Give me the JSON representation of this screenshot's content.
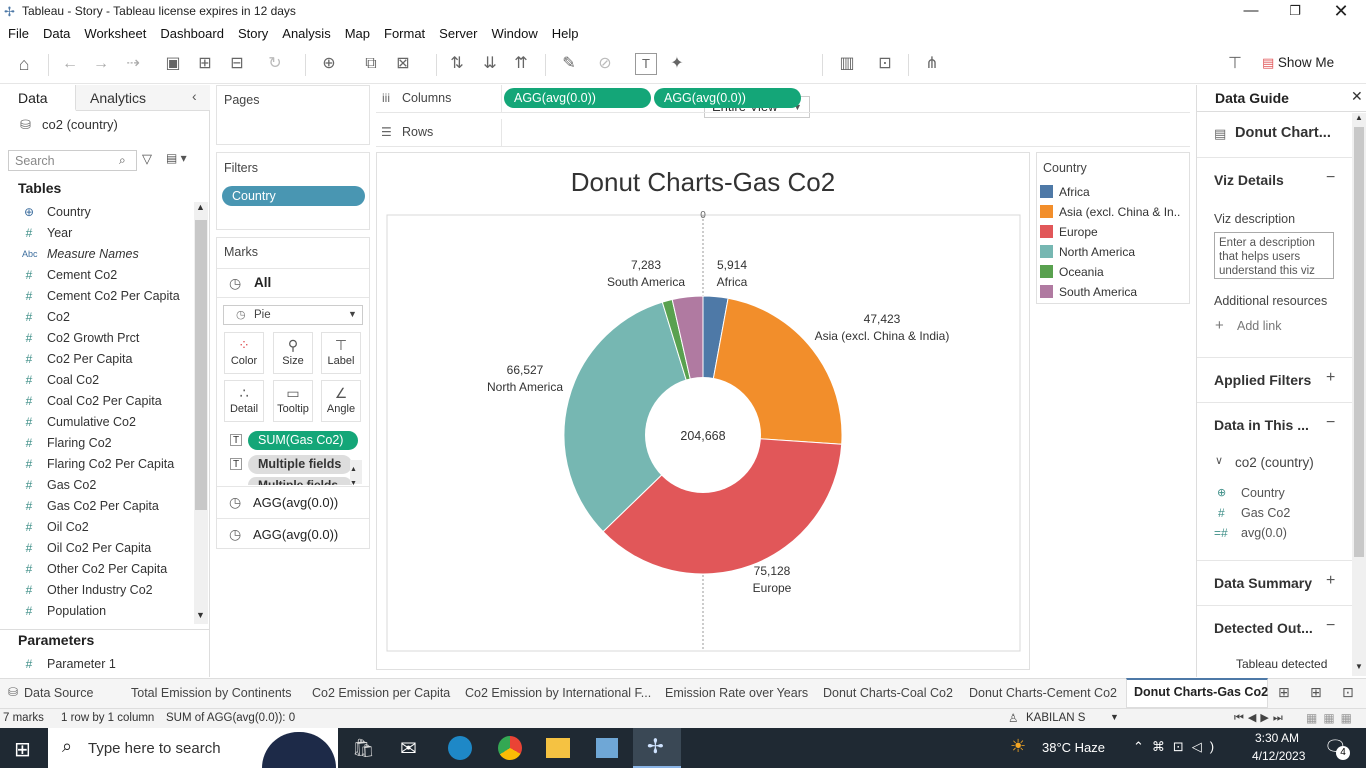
{
  "window": {
    "title": "Tableau - Story - Tableau license expires in 12 days"
  },
  "menu": [
    "File",
    "Data",
    "Worksheet",
    "Dashboard",
    "Story",
    "Analysis",
    "Map",
    "Format",
    "Server",
    "Window",
    "Help"
  ],
  "toolbar": {
    "fit_label": "Entire View",
    "show_me": "Show Me"
  },
  "left": {
    "tab_data": "Data",
    "tab_analytics": "Analytics",
    "datasource": "co2 (country)",
    "search_placeholder": "Search",
    "tables_label": "Tables",
    "parameters_label": "Parameters",
    "fields": [
      {
        "icon": "globe",
        "name": "Country"
      },
      {
        "icon": "hash",
        "name": "Year"
      },
      {
        "icon": "abc",
        "name": "Measure Names"
      },
      {
        "icon": "hash",
        "name": "Cement Co2"
      },
      {
        "icon": "hash",
        "name": "Cement Co2 Per Capita"
      },
      {
        "icon": "hash",
        "name": "Co2"
      },
      {
        "icon": "hash",
        "name": "Co2 Growth Prct"
      },
      {
        "icon": "hash",
        "name": "Co2 Per Capita"
      },
      {
        "icon": "hash",
        "name": "Coal Co2"
      },
      {
        "icon": "hash",
        "name": "Coal Co2 Per Capita"
      },
      {
        "icon": "hash",
        "name": "Cumulative Co2"
      },
      {
        "icon": "hash",
        "name": "Flaring Co2"
      },
      {
        "icon": "hash",
        "name": "Flaring Co2 Per Capita"
      },
      {
        "icon": "hash",
        "name": "Gas Co2"
      },
      {
        "icon": "hash",
        "name": "Gas Co2 Per Capita"
      },
      {
        "icon": "hash",
        "name": "Oil Co2"
      },
      {
        "icon": "hash",
        "name": "Oil Co2 Per Capita"
      },
      {
        "icon": "hash",
        "name": "Other Co2 Per Capita"
      },
      {
        "icon": "hash",
        "name": "Other Industry Co2"
      },
      {
        "icon": "hash",
        "name": "Population"
      }
    ],
    "parameter": "Parameter 1"
  },
  "shelves": {
    "pages": "Pages",
    "filters": "Filters",
    "filter_pill": "Country",
    "marks": "Marks",
    "columns": "Columns",
    "rows": "Rows",
    "col_pill_1": "AGG(avg(0.0))",
    "col_pill_2": "AGG(avg(0.0))",
    "marks_all": "All",
    "mark_type": "Pie",
    "mark_buttons": [
      "Color",
      "Size",
      "Label",
      "Detail",
      "Tooltip",
      "Angle"
    ],
    "mark_pill_1": "SUM(Gas Co2)",
    "mark_pill_2": "Multiple fields",
    "mark_pill_3": "Multiple fields",
    "marks_agg_1": "AGG(avg(0.0))",
    "marks_agg_2": "AGG(avg(0.0))"
  },
  "chart_data": {
    "type": "pie",
    "title": "Donut Charts-Gas Co2",
    "center_label": "204,668",
    "axis_tick": "0",
    "categories": [
      "Africa",
      "Asia (excl. China & India)",
      "Europe",
      "North America",
      "Oceania",
      "South America"
    ],
    "values": [
      5914,
      47423,
      75128,
      66527,
      2393,
      7283
    ],
    "value_labels": [
      "5,914",
      "47,423",
      "75,128",
      "66,527",
      "",
      "7,283"
    ],
    "colors": [
      "#4e79a7",
      "#f28e2b",
      "#e15759",
      "#76b7b2",
      "#59a14f",
      "#b07aa1"
    ]
  },
  "legend": {
    "title": "Country",
    "items": [
      "Africa",
      "Asia (excl. China & In..",
      "Europe",
      "North America",
      "Oceania",
      "South America"
    ]
  },
  "guide": {
    "title": "Data Guide",
    "sheet": "Donut Chart...",
    "viz_details": "Viz Details",
    "viz_desc_label": "Viz description",
    "viz_desc_placeholder": "Enter a description that helps users understand this viz",
    "additional": "Additional resources",
    "add_link": "Add link",
    "applied_filters": "Applied Filters",
    "data_in": "Data in This ...",
    "source": "co2 (country)",
    "fields": [
      "Country",
      "Gas Co2",
      "avg(0.0)"
    ],
    "data_summary": "Data Summary",
    "detected": "Detected Out...",
    "detected_text": "Tableau detected"
  },
  "tabs": [
    "Data Source",
    "Total Emission by Continents",
    "Co2 Emission per Capita",
    "Co2 Emission by International F...",
    "Emission Rate over Years",
    "Donut Charts-Coal Co2",
    "Donut Charts-Cement Co2",
    "Donut Charts-Gas Co2"
  ],
  "status": {
    "marks": "7 marks",
    "rowcol": "1 row by 1 column",
    "sum": "SUM of AGG(avg(0.0)): 0",
    "user": "KABILAN S"
  },
  "taskbar": {
    "search": "Type here to search",
    "weather": "38°C  Haze",
    "time": "3:30 AM",
    "date": "4/12/2023",
    "notif": "4"
  }
}
